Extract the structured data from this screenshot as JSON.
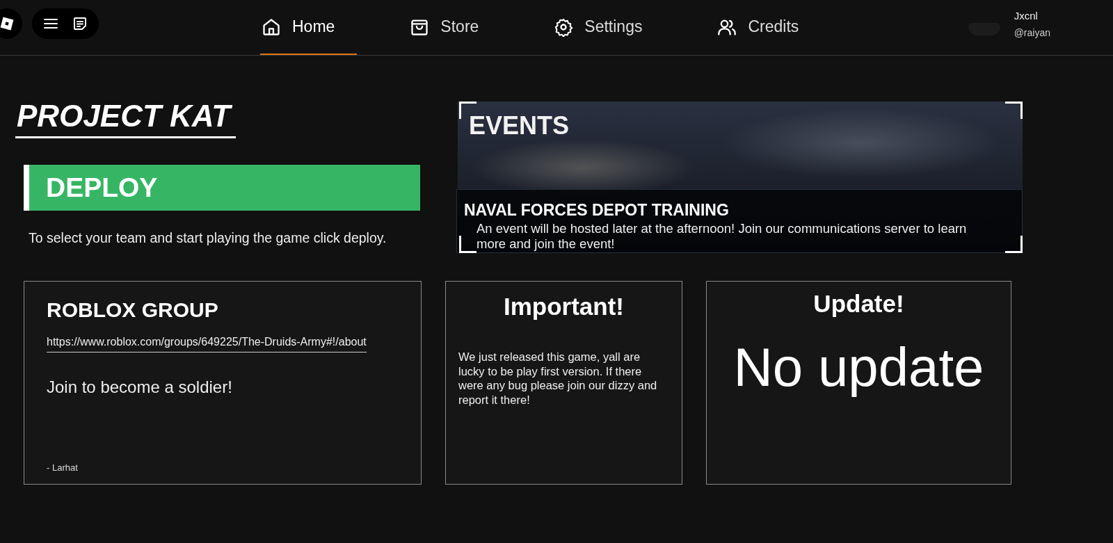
{
  "topbar": {
    "nav": [
      {
        "label": "Home",
        "kind": "home",
        "selected": true
      },
      {
        "label": "Store",
        "kind": "store",
        "selected": false
      },
      {
        "label": "Settings",
        "kind": "settings",
        "selected": false
      },
      {
        "label": "Credits",
        "kind": "credits",
        "selected": false
      }
    ],
    "user": {
      "display_name": "Jxcnl",
      "username": "@raiyan"
    }
  },
  "title": "PROJECT KAT",
  "deploy": {
    "label": "DEPLOY",
    "description": "To select your team and start playing the game click deploy."
  },
  "events": {
    "title": "EVENTS",
    "event_name": "NAVAL FORCES DEPOT TRAINING",
    "event_description": "An event will be hosted later at the afternoon! Join our communications server to learn more and join the event!"
  },
  "cards": [
    {
      "kind": "group",
      "title": "ROBLOX GROUP",
      "link": "https://www.roblox.com/groups/649225/The-Druids-Army#!/about",
      "message": "Join to become a soldier!",
      "signature": "- Larhat"
    },
    {
      "kind": "notice",
      "title": "Important!",
      "body": "We just released this game, yall are lucky to be play first version. If there were any bug please join our dizzy and report it there!"
    },
    {
      "kind": "update",
      "title": "Update!",
      "body": "No update"
    }
  ]
}
